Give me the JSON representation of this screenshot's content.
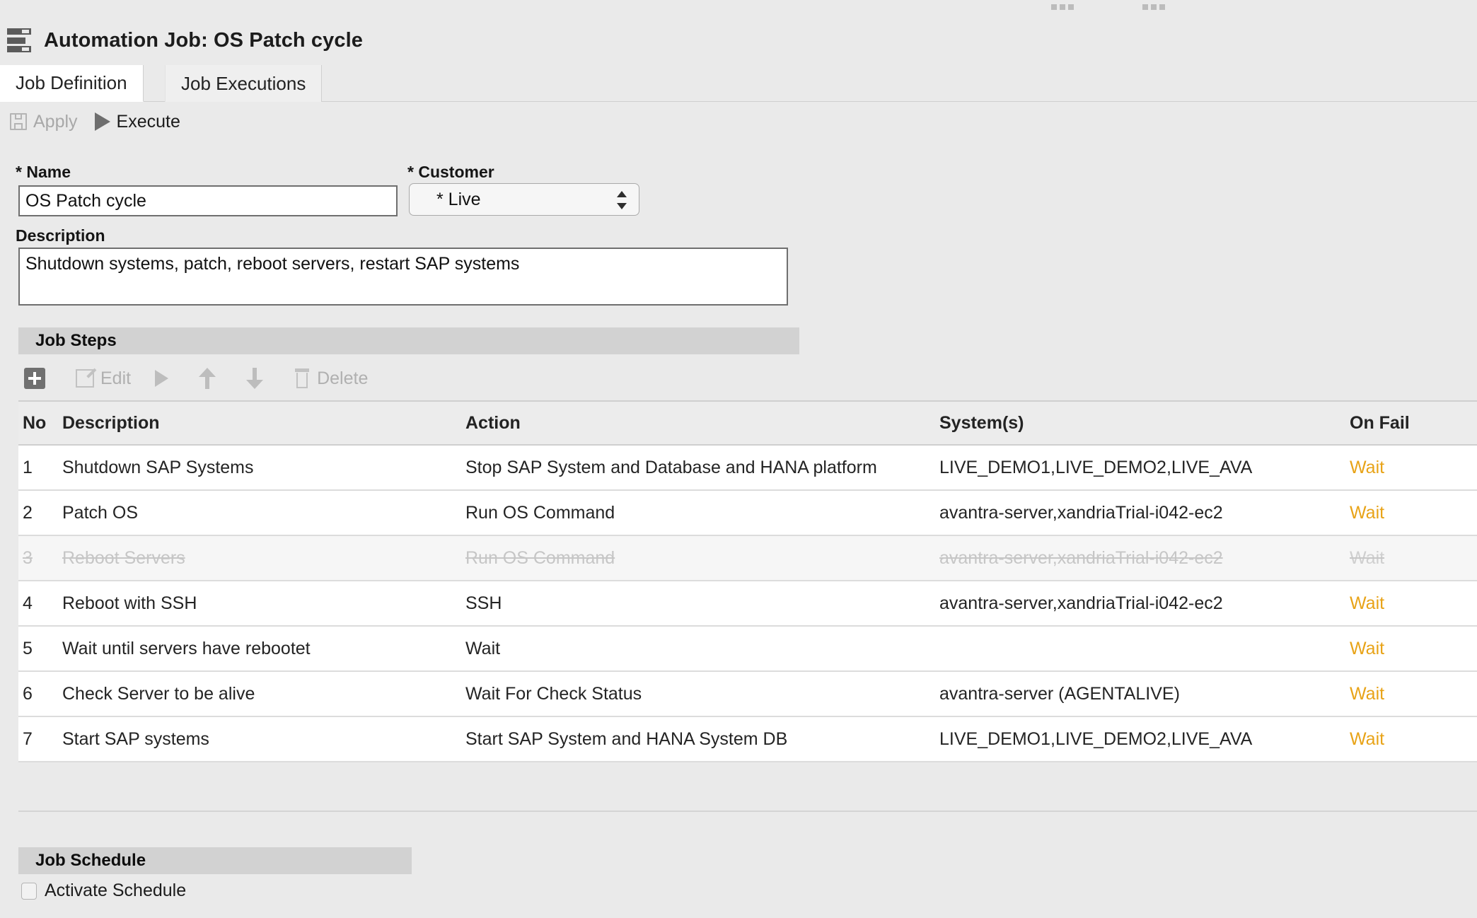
{
  "window": {
    "title": "Automation Job: OS Patch cycle",
    "app_icon": "list-panel-icon"
  },
  "tabs": [
    {
      "label": "Job Definition",
      "active": true
    },
    {
      "label": "Job Executions",
      "active": false
    }
  ],
  "action_bar": {
    "apply_label": "Apply",
    "execute_label": "Execute"
  },
  "form": {
    "name_label": "* Name",
    "name_value": "OS Patch cycle",
    "name_placeholder": "",
    "customer_label": "* Customer",
    "customer_value": "* Live",
    "customer_options": [
      "* Live"
    ],
    "description_label": "Description",
    "description_value": "Shutdown systems, patch, reboot servers, restart SAP systems",
    "description_placeholder": ""
  },
  "job_steps": {
    "section_title": "Job Steps",
    "toolbar": {
      "add_label": "",
      "edit_label": "Edit",
      "run_label": "",
      "move_up_label": "",
      "move_down_label": "",
      "delete_label": "Delete"
    },
    "columns": {
      "no": "No",
      "description": "Description",
      "action": "Action",
      "systems": "System(s)",
      "on_fail": "On Fail"
    },
    "rows": [
      {
        "no": "1",
        "description": "Shutdown SAP Systems",
        "action": "Stop SAP System and Database and HANA platform",
        "systems": "LIVE_DEMO1,LIVE_DEMO2,LIVE_AVA",
        "on_fail": "Wait",
        "disabled": false
      },
      {
        "no": "2",
        "description": "Patch OS",
        "action": "Run OS Command",
        "systems": "avantra-server,xandriaTrial-i042-ec2",
        "on_fail": "Wait",
        "disabled": false
      },
      {
        "no": "3",
        "description": "Reboot Servers",
        "action": "Run OS Command",
        "systems": "avantra-server,xandriaTrial-i042-ec2",
        "on_fail": "Wait",
        "disabled": true
      },
      {
        "no": "4",
        "description": "Reboot with SSH",
        "action": "SSH",
        "systems": "avantra-server,xandriaTrial-i042-ec2",
        "on_fail": "Wait",
        "disabled": false
      },
      {
        "no": "5",
        "description": "Wait until servers have rebootet",
        "action": "Wait",
        "systems": "",
        "on_fail": "Wait",
        "disabled": false
      },
      {
        "no": "6",
        "description": "Check Server to be alive",
        "action": "Wait For Check Status",
        "systems": "avantra-server (AGENTALIVE)",
        "on_fail": "Wait",
        "disabled": false
      },
      {
        "no": "7",
        "description": "Start SAP systems",
        "action": "Start SAP System and HANA System DB",
        "systems": "LIVE_DEMO1,LIVE_DEMO2,LIVE_AVA",
        "on_fail": "Wait",
        "disabled": false
      }
    ]
  },
  "job_schedule": {
    "section_title": "Job Schedule",
    "activate_label": "Activate Schedule",
    "activate_checked": false
  },
  "colors": {
    "on_fail_accent": "#e8a317",
    "section_bar": "#d2d2d2",
    "page_bg": "#eaeaea",
    "disabled_text": "#c6c6c6"
  }
}
